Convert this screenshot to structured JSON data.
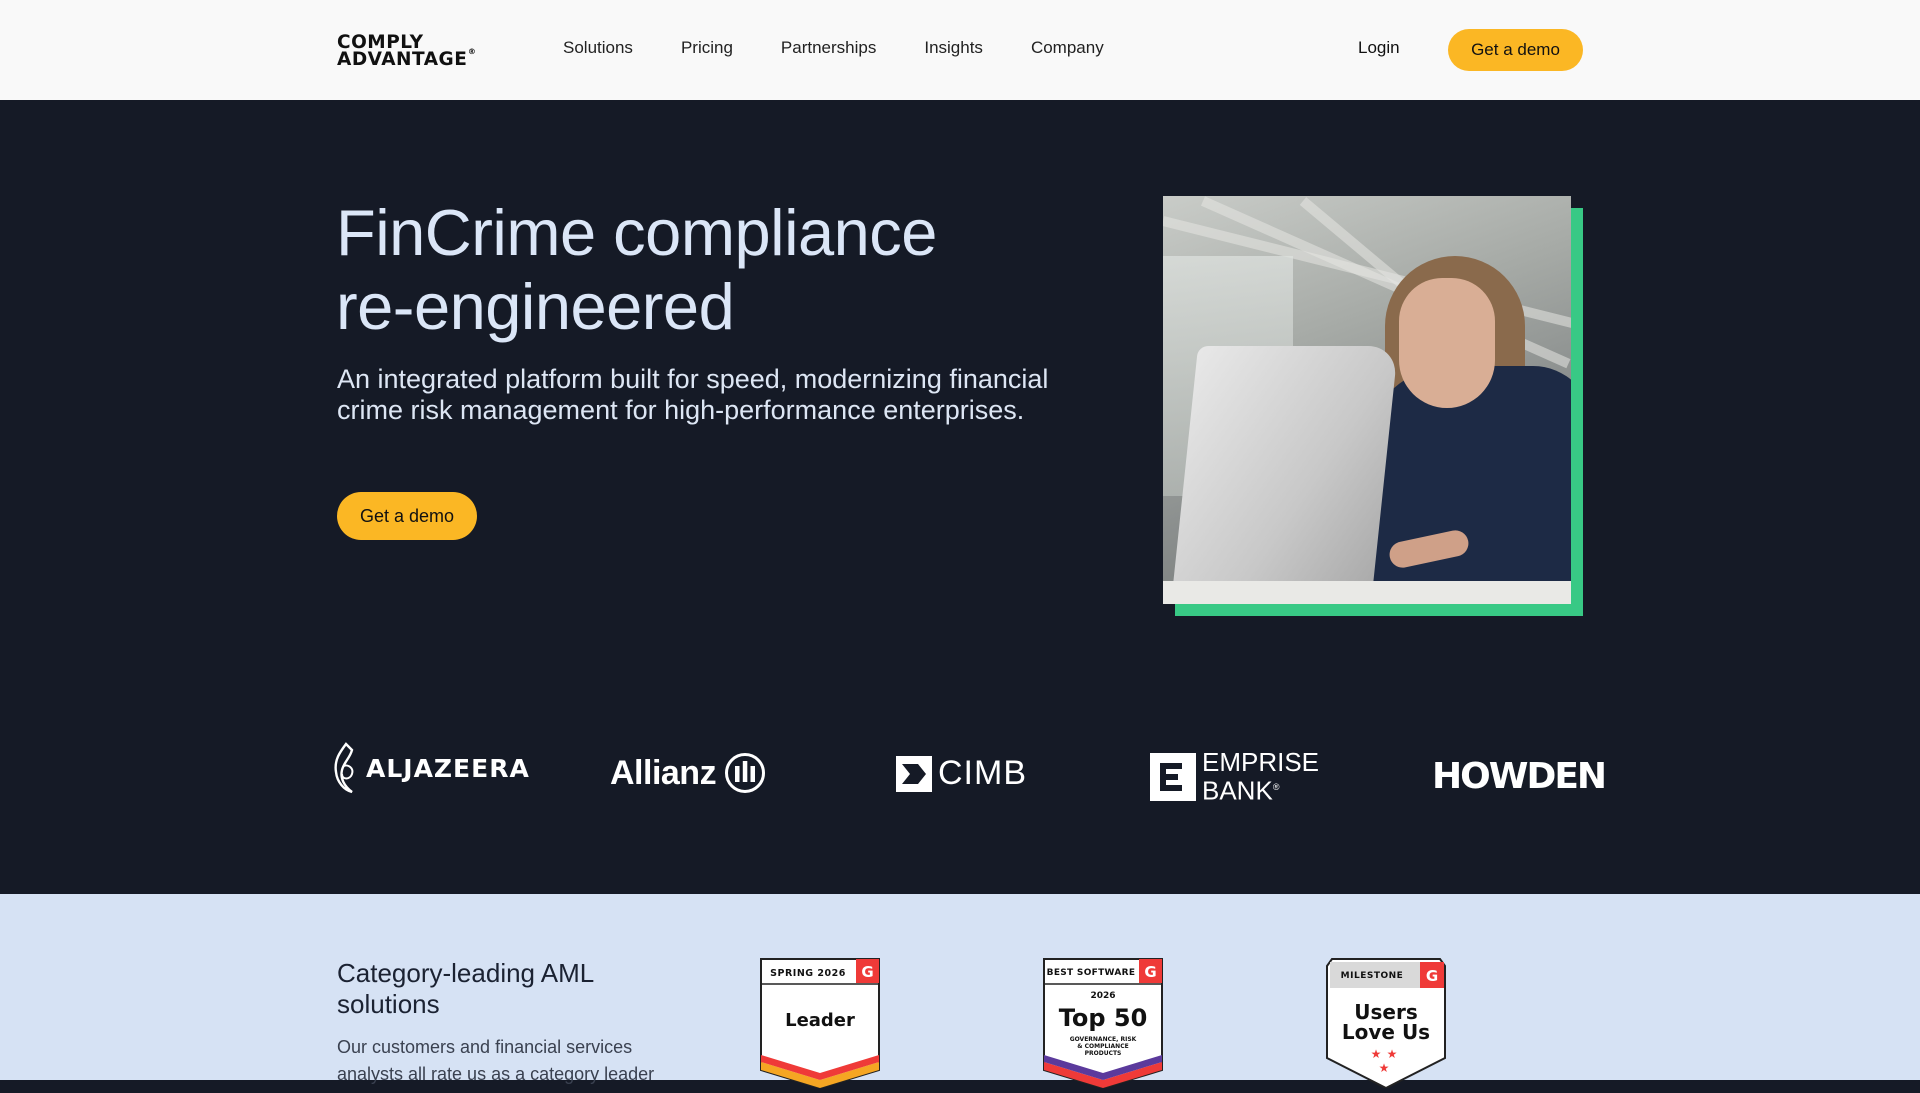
{
  "header": {
    "logo_line1": "COMPLY",
    "logo_line2": "ADVANTAGE",
    "logo_reg": "®",
    "nav": [
      "Solutions",
      "Pricing",
      "Partnerships",
      "Insights",
      "Company"
    ],
    "login_label": "Login",
    "cta_label": "Get a demo"
  },
  "hero": {
    "title_line1": "FinCrime compliance",
    "title_line2": "re-engineered",
    "subtitle": "An integrated platform built for speed, modernizing financial crime risk management for high-performance enterprises.",
    "cta_label": "Get a demo"
  },
  "clients": {
    "aljazeera": "ALJAZEERA",
    "allianz": "Allianz",
    "cimb": "CIMB",
    "emprise_line1": "EMPRISE",
    "emprise_line2": "BANK",
    "emprise_reg": "®",
    "howden": "HOWDEN"
  },
  "awards": {
    "title": "Category-leading AML solutions",
    "text": "Our customers and financial services analysts all rate us as a category leader",
    "badges": [
      {
        "top": "SPRING 2026",
        "main": "Leader"
      },
      {
        "top": "BEST SOFTWARE",
        "year": "2026",
        "main": "Top 50",
        "sub1": "GOVERNANCE, RISK",
        "sub2": "& COMPLIANCE",
        "sub3": "PRODUCTS"
      },
      {
        "top": "MILESTONE",
        "main1": "Users",
        "main2": "Love Us"
      }
    ]
  },
  "colors": {
    "header_bg": "#f9f9f9",
    "hero_bg": "#151a26",
    "cta": "#fbb724",
    "accent_green": "#38c985",
    "awards_bg": "#d6e2f4",
    "g2_red": "#ef3a38"
  }
}
